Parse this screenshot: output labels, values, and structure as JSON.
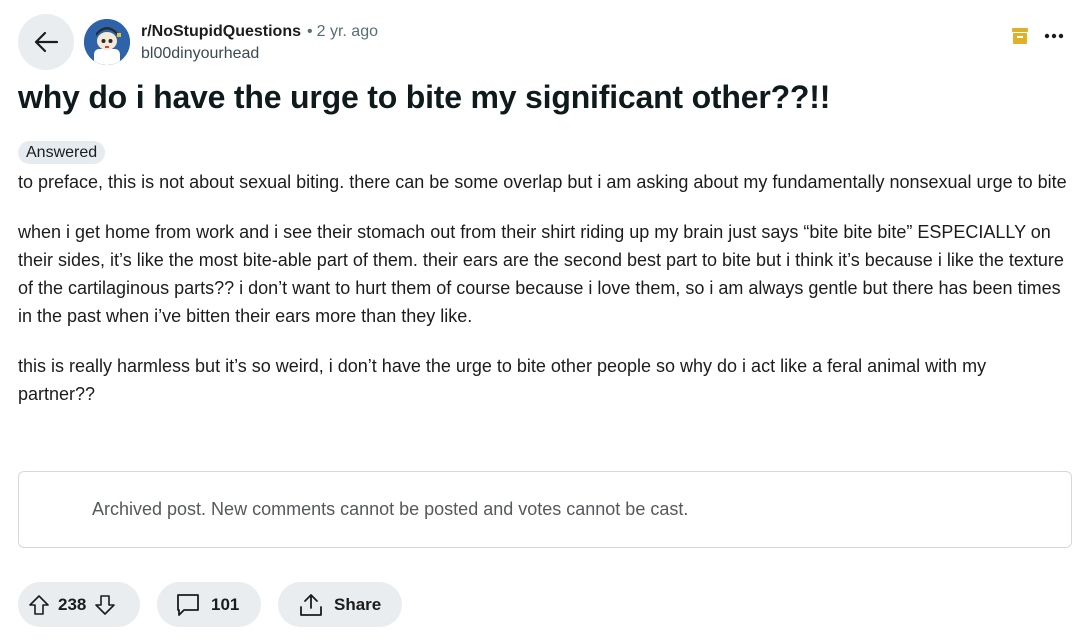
{
  "header": {
    "subreddit": "r/NoStupidQuestions",
    "separator": "•",
    "age": "2 yr. ago",
    "author": "bl00dinyourhead",
    "icons": [
      "back-arrow-icon",
      "avatar",
      "archive-box-icon",
      "more-options-icon"
    ],
    "accent_color": "#e0b128"
  },
  "post": {
    "title": "why do i have the urge to bite my significant other??!!",
    "flair": "Answered",
    "paragraphs": [
      "to preface, this is not about sexual biting. there can be some overlap but i am asking about my fundamentally nonsexual urge to bite",
      "when i get home from work and i see their stomach out from their shirt riding up my brain just says “bite bite bite” ESPECIALLY on their sides, it’s like the most bite-able part of them. their ears are the second best part to bite but i think it’s because i like the texture of the cartilaginous parts?? i don’t want to hurt them of course because i love them, so i am always gentle but there has been times in the past when i’ve bitten their ears more than they like.",
      "this is really harmless but it’s so weird, i don’t have the urge to bite other people so why do i act like a feral animal with my partner??"
    ]
  },
  "archived_notice": "Archived post. New comments cannot be posted and votes cannot be cast.",
  "actions": {
    "votes": "238",
    "comments": "101",
    "share_label": "Share",
    "icons": [
      "upvote-icon",
      "downvote-icon",
      "comment-icon",
      "share-icon"
    ]
  }
}
